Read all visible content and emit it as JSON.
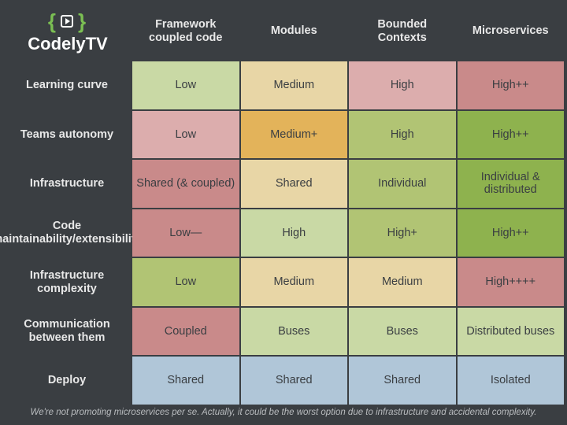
{
  "logo_text": "CodelyTV",
  "columns": [
    "Framework coupled code",
    "Modules",
    "Bounded Contexts",
    "Microservices"
  ],
  "rows": [
    {
      "label": "Learning curve",
      "cells": [
        {
          "v": "Low",
          "c": "c-greenL"
        },
        {
          "v": "Medium",
          "c": "c-tan"
        },
        {
          "v": "High",
          "c": "c-roseL"
        },
        {
          "v": "High++",
          "c": "c-rose"
        }
      ]
    },
    {
      "label": "Teams autonomy",
      "cells": [
        {
          "v": "Low",
          "c": "c-roseL"
        },
        {
          "v": "Medium+",
          "c": "c-mustard"
        },
        {
          "v": "High",
          "c": "c-olive"
        },
        {
          "v": "High++",
          "c": "c-green"
        }
      ]
    },
    {
      "label": "Infrastructure",
      "cells": [
        {
          "v": "Shared (& coupled)",
          "c": "c-rose"
        },
        {
          "v": "Shared",
          "c": "c-tan"
        },
        {
          "v": "Individual",
          "c": "c-olive"
        },
        {
          "v": "Individual & distributed",
          "c": "c-green"
        }
      ]
    },
    {
      "label": "Code maintainability/extensibility",
      "cells": [
        {
          "v": "Low—",
          "c": "c-rose"
        },
        {
          "v": "High",
          "c": "c-greenL"
        },
        {
          "v": "High+",
          "c": "c-olive"
        },
        {
          "v": "High++",
          "c": "c-green"
        }
      ]
    },
    {
      "label": "Infrastructure complexity",
      "cells": [
        {
          "v": "Low",
          "c": "c-olive"
        },
        {
          "v": "Medium",
          "c": "c-tan"
        },
        {
          "v": "Medium",
          "c": "c-tan"
        },
        {
          "v": "High++++",
          "c": "c-rose"
        }
      ]
    },
    {
      "label": "Communication between them",
      "cells": [
        {
          "v": "Coupled",
          "c": "c-rose"
        },
        {
          "v": "Buses",
          "c": "c-greenL"
        },
        {
          "v": "Buses",
          "c": "c-greenL"
        },
        {
          "v": "Distributed buses",
          "c": "c-greenL"
        }
      ]
    },
    {
      "label": "Deploy",
      "cells": [
        {
          "v": "Shared",
          "c": "c-blue"
        },
        {
          "v": "Shared",
          "c": "c-blue"
        },
        {
          "v": "Shared",
          "c": "c-blue"
        },
        {
          "v": "Isolated",
          "c": "c-blue"
        }
      ]
    }
  ],
  "footer": "We're not promoting microservices per se. Actually, it could be the worst option due to infrastructure and accidental complexity."
}
